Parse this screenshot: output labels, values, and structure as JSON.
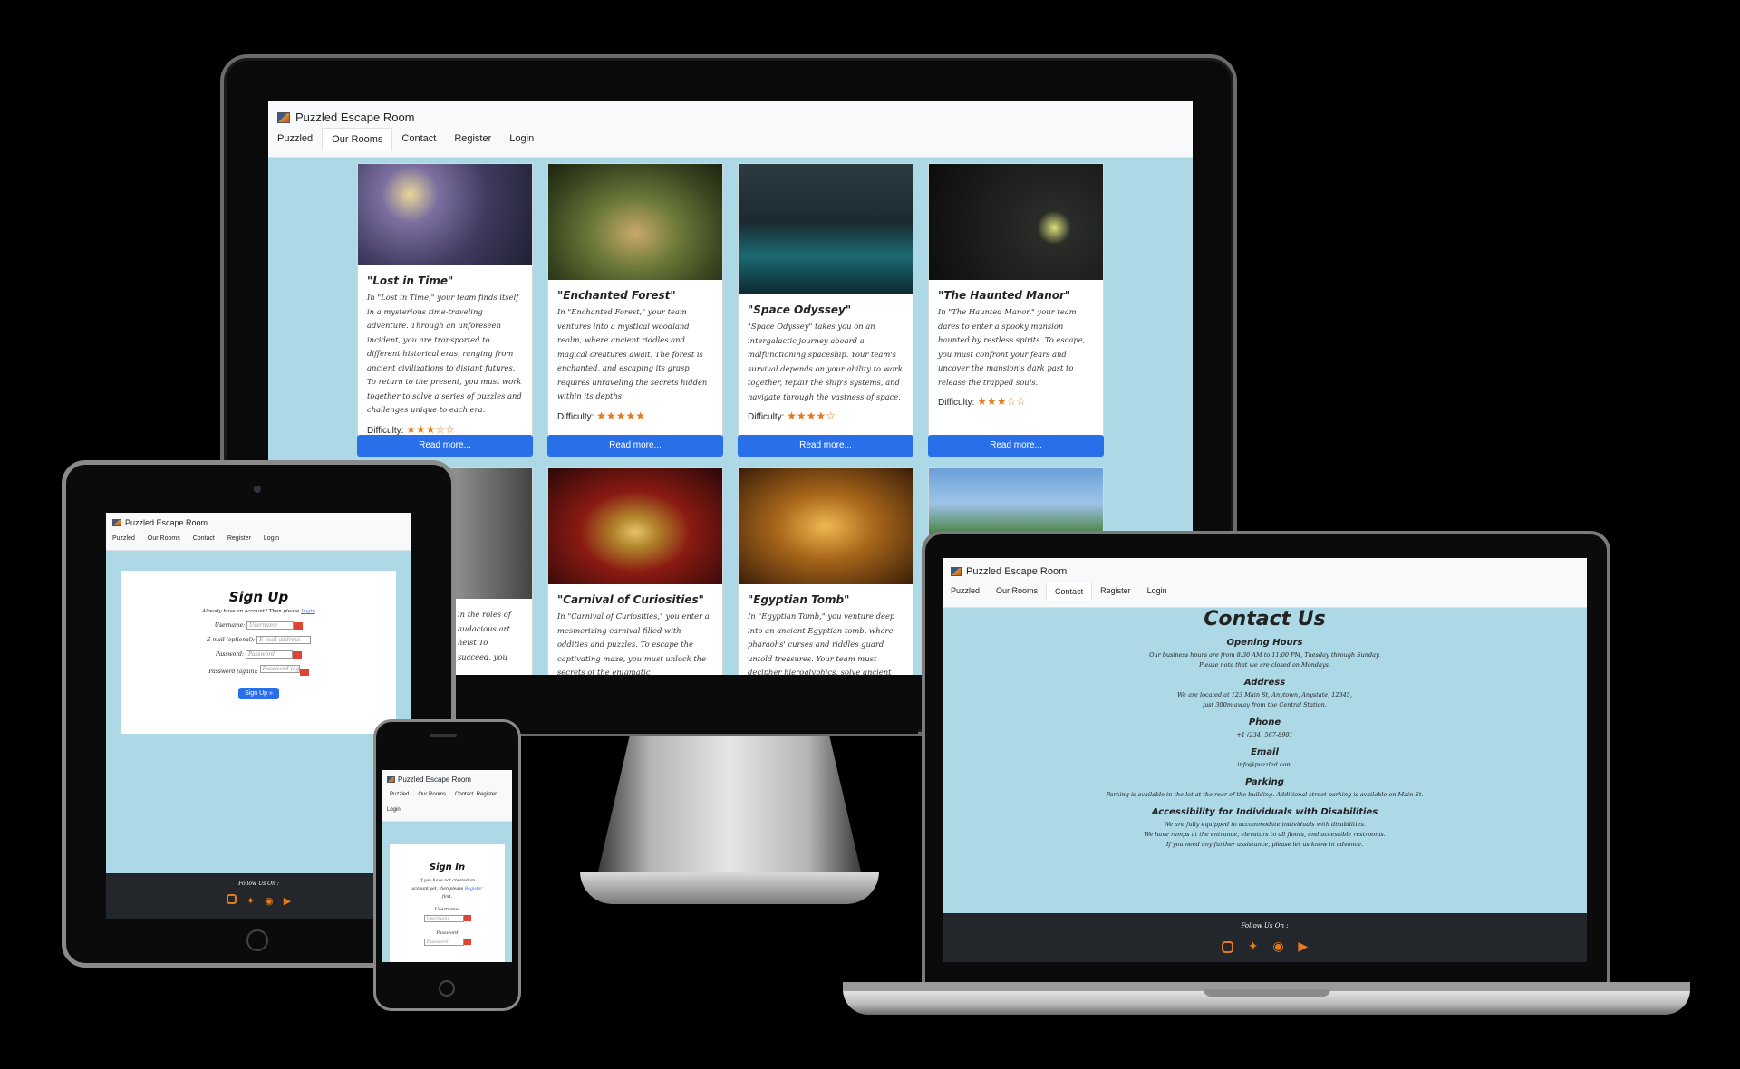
{
  "brand": "Puzzled Escape Room",
  "nav": [
    "Puzzled",
    "Our Rooms",
    "Contact",
    "Register",
    "Login"
  ],
  "rooms": [
    {
      "title": "\"Lost in Time\"",
      "desc": "In \"Lost in Time,\" your team finds itself in a mysterious time-traveling adventure. Through an unforeseen incident, you are transported to different historical eras, ranging from ancient civilizations to distant futures. To return to the present, you must work together to solve a series of puzzles and challenges unique to each era.",
      "difficulty": 3,
      "stars": "★★★☆☆"
    },
    {
      "title": "\"Enchanted Forest\"",
      "desc": "In \"Enchanted Forest,\" your team ventures into a mystical woodland realm, where ancient riddles and magical creatures await. The forest is enchanted, and escaping its grasp requires unraveling the secrets hidden within its depths.",
      "difficulty": 5,
      "stars": "★★★★★"
    },
    {
      "title": "\"Space Odyssey\"",
      "desc": "\"Space Odyssey\" takes you on an intergalactic journey aboard a malfunctioning spaceship. Your team's survival depends on your ability to work together, repair the ship's systems, and navigate through the vastness of space.",
      "difficulty": 4,
      "stars": "★★★★☆"
    },
    {
      "title": "\"The Haunted Manor\"",
      "desc": "In \"The Haunted Manor,\" your team dares to enter a spooky mansion haunted by restless spirits. To escape, you must confront your fears and uncover the mansion's dark past to release the trapped souls.",
      "difficulty": 3,
      "stars": "★★★☆☆"
    }
  ],
  "rooms2": [
    {
      "title": "",
      "desc": "in the roles of audacious art heist To succeed, you"
    },
    {
      "title": "\"Carnival of Curiosities\"",
      "desc": "In \"Carnival of Curiosities,\" you enter a mesmerizing carnival filled with oddities and puzzles. To escape the captivating maze, you must unlock the secrets of the enigmatic"
    },
    {
      "title": "\"Egyptian Tomb\"",
      "desc": "In \"Egyptian Tomb,\" you venture deep into an ancient Egyptian tomb, where pharaohs' curses and riddles guard untold treasures. Your team must decipher hieroglyphics, solve ancient"
    },
    {
      "title": "",
      "desc": ""
    }
  ],
  "difficulty_label": "Difficulty:",
  "read_more": "Read more...",
  "signup": {
    "title": "Sign Up",
    "already": "Already have an account? Then please",
    "login_link": "Login",
    "username_label": "Username:",
    "username_ph": "Username",
    "email_label": "E-mail (optional):",
    "email_ph": "E-mail address",
    "password_label": "Password:",
    "password_ph": "Password",
    "password2_label": "Password (again):",
    "password2_ph": "Password (again)",
    "button": "Sign Up »"
  },
  "signin": {
    "title": "Sign In",
    "line1": "If you have not created an",
    "line2": "account yet, then please",
    "register_link": "Register",
    "line3": "first.",
    "username_label": "Username:",
    "username_ph": "Username",
    "password_label": "Password",
    "password_ph": "Password"
  },
  "contact": {
    "title": "Contact Us",
    "sections": [
      {
        "h": "Opening Hours",
        "t": [
          "Our business hours are from 8:30 AM to 11:00 PM, Tuesday through Sunday.",
          "Please note that we are closed on Mondays."
        ]
      },
      {
        "h": "Address",
        "t": [
          "We are located at 123 Main St, Anytown, Anystate, 12345,",
          "just 300m away from the Central Station."
        ]
      },
      {
        "h": "Phone",
        "t": [
          "+1 (234) 567-8901"
        ]
      },
      {
        "h": "Email",
        "t": [
          "info@puzzled.com"
        ]
      },
      {
        "h": "Parking",
        "t": [
          "Parking is available in the lot at the rear of the building. Additional street parking is available on Main St."
        ]
      },
      {
        "h": "Accessibility for Individuals with Disabilities",
        "t": [
          "We are fully equipped to accommodate individuals with disabilities.",
          "We have ramps at the entrance, elevators to all floors, and accessible restrooms.",
          "If you need any further assistance, please let us know in advance."
        ]
      }
    ]
  },
  "footer": {
    "follow": "Follow Us On :"
  },
  "social_icons": [
    "instagram-icon",
    "twitter-icon",
    "facebook-icon",
    "youtube-icon"
  ],
  "colors": {
    "accent": "#e37b1c",
    "content_bg": "#add8e6",
    "button": "#2a6fea",
    "footer": "#23272b"
  }
}
